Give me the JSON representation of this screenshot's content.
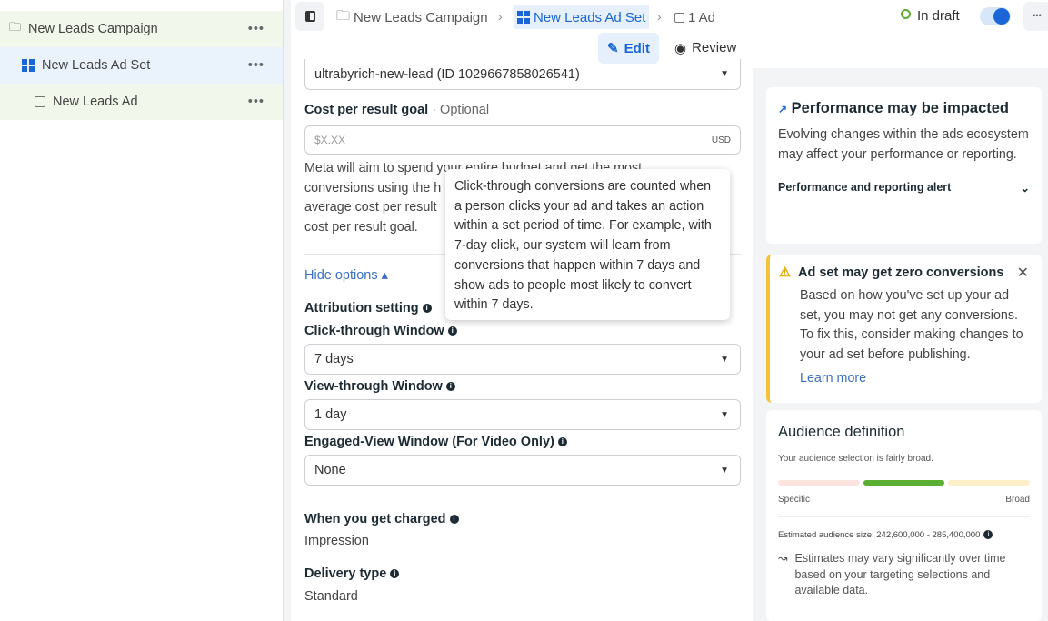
{
  "sidebar": {
    "items": [
      {
        "label": "New Leads Campaign",
        "icon": "folder-icon",
        "more": "•••"
      },
      {
        "label": "New Leads Ad Set",
        "icon": "grid-icon",
        "more": "•••"
      },
      {
        "label": "New Leads Ad",
        "icon": "ad-icon",
        "more": "•••"
      }
    ]
  },
  "topbar": {
    "crumbs": [
      "New Leads Campaign",
      "New Leads Ad Set",
      "1 Ad"
    ],
    "status": "In draft",
    "toggle_on": true,
    "more": "•••",
    "edit": "Edit",
    "review": "Review"
  },
  "form": {
    "pixel_value": "ultrabyrich-new-lead (ID 1029667858026541)",
    "cost_label": "Cost per result goal",
    "cost_optional": "· Optional",
    "cost_placeholder": "$X.XX",
    "currency": "USD",
    "desc_lines": [
      "Meta will aim to spend your entire budget and get the most",
      "conversions using the h",
      "average cost per result",
      "cost per result goal."
    ],
    "hide_options": "Hide options ▴",
    "attribution": "Attribution setting",
    "click_label": "Click-through Window",
    "click_value": "7 days",
    "view_label": "View-through Window",
    "view_value": "1 day",
    "engaged_label": "Engaged-View Window (For Video Only)",
    "engaged_value": "None",
    "charged_label": "When you get charged",
    "charged_value": "Impression",
    "delivery_label": "Delivery type",
    "delivery_value": "Standard"
  },
  "tooltip": "Click-through conversions are counted when a person clicks your ad and takes an action within a set period of time. For example, with 7-day click, our system will learn from conversions that happen within 7 days and show ads to people most likely to convert within 7 days.",
  "perf": {
    "title": "Performance may be impacted",
    "body": "Evolving changes within the ads ecosystem may affect your performance or reporting.",
    "alert": "Performance and reporting alert"
  },
  "warn": {
    "title": "Ad set may get zero conversions",
    "body": "Based on how you've set up your ad set, you may not get any conversions. To fix this, consider making changes to your ad set before publishing.",
    "link": "Learn more"
  },
  "audience": {
    "title": "Audience definition",
    "subtitle": "Your audience selection is fairly broad.",
    "level": "middle",
    "specific": "Specific",
    "broad": "Broad",
    "size": "Estimated audience size: 242,600,000 - 285,400,000",
    "note": "Estimates may vary significantly over time based on your targeting selections and available data."
  },
  "colors": {
    "accent": "#1a66d6",
    "green": "#5aae32",
    "warn": "#f5c33b"
  }
}
